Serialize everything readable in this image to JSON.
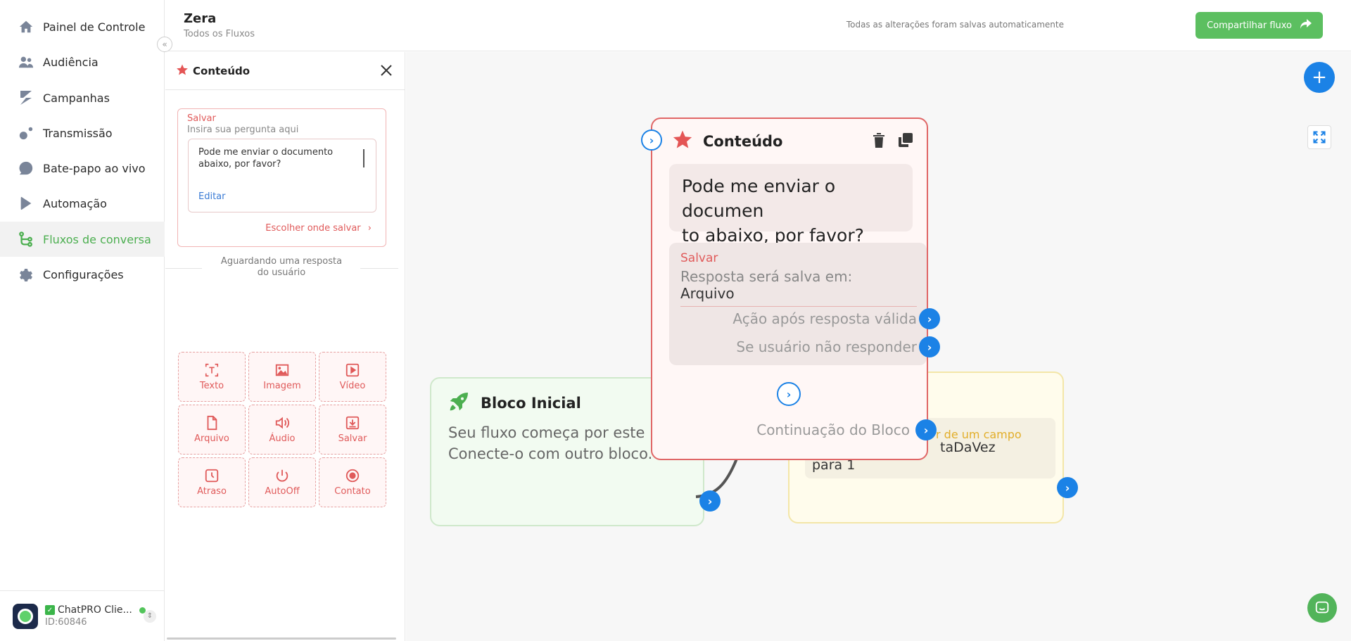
{
  "sidebar": {
    "items": [
      {
        "label": "Painel de Controle",
        "icon": "home-icon"
      },
      {
        "label": "Audiência",
        "icon": "users-icon"
      },
      {
        "label": "Campanhas",
        "icon": "campaign-icon"
      },
      {
        "label": "Transmissão",
        "icon": "broadcast-icon"
      },
      {
        "label": "Bate-papo ao vivo",
        "icon": "chat-icon"
      },
      {
        "label": "Automação",
        "icon": "automation-icon"
      },
      {
        "label": "Fluxos de conversa",
        "icon": "flow-icon"
      },
      {
        "label": "Configurações",
        "icon": "gear-icon"
      }
    ],
    "active_index": 6,
    "account": {
      "name": "ChatPRO Clie...",
      "id": "ID:60846"
    }
  },
  "header": {
    "title": "Zera",
    "subtitle": "Todos os Fluxos",
    "status": "Todas as alterações foram salvas automaticamente",
    "share_label": "Compartilhar fluxo"
  },
  "panel": {
    "title": "Conteúdo",
    "save_label": "Salvar",
    "question_placeholder": "Insira sua pergunta aqui",
    "message": "Pode me enviar o documento abaixo, por favor?",
    "edit_label": "Editar",
    "choose_save": "Escolher onde salvar",
    "awaiting": "Aguardando uma resposta do usuário",
    "tools": [
      {
        "label": "Texto",
        "icon": "text-icon"
      },
      {
        "label": "Imagem",
        "icon": "image-icon"
      },
      {
        "label": "Vídeo",
        "icon": "video-icon"
      },
      {
        "label": "Arquivo",
        "icon": "file-icon"
      },
      {
        "label": "Áudio",
        "icon": "audio-icon"
      },
      {
        "label": "Salvar",
        "icon": "save-icon"
      },
      {
        "label": "Atraso",
        "icon": "clock-icon"
      },
      {
        "label": "AutoOff",
        "icon": "power-icon"
      },
      {
        "label": "Contato",
        "icon": "contact-icon"
      }
    ]
  },
  "canvas": {
    "start_node": {
      "title": "Bloco Inicial",
      "body_line1": "Seu fluxo começa por este b",
      "body_line2": "Conecte-o com outro bloco."
    },
    "set_node": {
      "label": "r de um campo",
      "value_line1": "taDaVez",
      "value_line2": "para 1"
    },
    "content_node": {
      "title": "Conteúdo",
      "message_line1": "Pode me enviar o documen",
      "message_line2": "to abaixo, por favor?",
      "save_label": "Salvar",
      "save_placeholder": "Resposta será salva em:",
      "save_value": "Arquivo",
      "action_valid": "Ação após resposta válida",
      "no_response": "Se usuário não responder",
      "continuation": "Continuação do Bloco"
    }
  },
  "colors": {
    "accent_green": "#5cbf60",
    "accent_blue": "#1b82e6",
    "content_red": "#e06666"
  }
}
